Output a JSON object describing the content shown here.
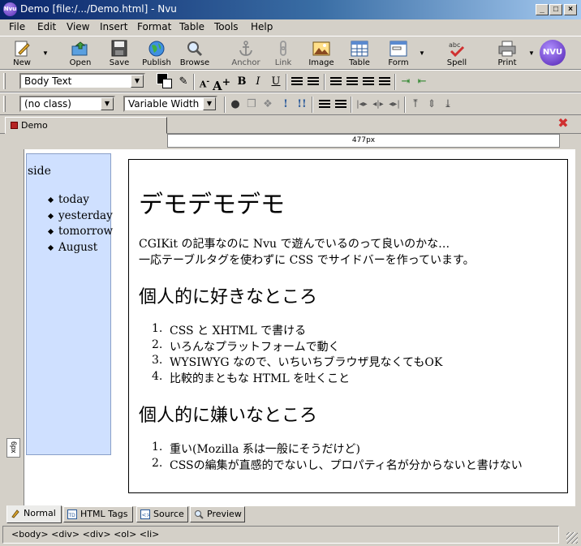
{
  "window": {
    "title": "Demo [file:/.../Demo.html] - Nvu",
    "app_icon": "Nvu"
  },
  "menubar": [
    "File",
    "Edit",
    "View",
    "Insert",
    "Format",
    "Table",
    "Tools",
    "Help"
  ],
  "toolbar": {
    "new": "New",
    "open": "Open",
    "save": "Save",
    "publish": "Publish",
    "browse": "Browse",
    "anchor": "Anchor",
    "link": "Link",
    "image": "Image",
    "table": "Table",
    "form": "Form",
    "spell": "Spell",
    "print": "Print",
    "brand": "NVU"
  },
  "format_bar": {
    "paragraph_style": "Body Text",
    "class": "(no class)",
    "width_mode": "Variable Width"
  },
  "tabs": {
    "document": "Demo"
  },
  "ruler": {
    "width_label": "477px"
  },
  "vertical_ruler": {
    "label": "6px"
  },
  "sidebar": {
    "title": "side",
    "items": [
      "today",
      "yesterday",
      "tomorrow",
      "August"
    ]
  },
  "content": {
    "heading": "デモデモデモ",
    "paragraph_line1": "CGIKit の記事なのに Nvu で遊んでいるのって良いのかな…",
    "paragraph_line2": "一応テーブルタグを使わずに CSS でサイドバーを作っています。",
    "likes_heading": "個人的に好きなところ",
    "likes": [
      "CSS と XHTML で書ける",
      "いろんなプラットフォームで動く",
      "WYSIWYG なので、いちいちブラウザ見なくてもOK",
      "比較的まともな HTML を吐くこと"
    ],
    "dislikes_heading": "個人的に嫌いなところ",
    "dislikes": [
      "重い(Mozilla 系は一般にそうだけど)",
      "CSSの編集が直感的でないし、プロパティ名が分からないと書けない"
    ]
  },
  "view_tabs": [
    "Normal",
    "HTML Tags",
    "Source",
    "Preview"
  ],
  "status": {
    "path": "<body>  <div>  <div>  <ol>  <li>"
  },
  "colors": {
    "titlebar_start": "#0a246a",
    "sidebar_bg": "#cfe0ff",
    "chrome": "#d4d0c8"
  }
}
